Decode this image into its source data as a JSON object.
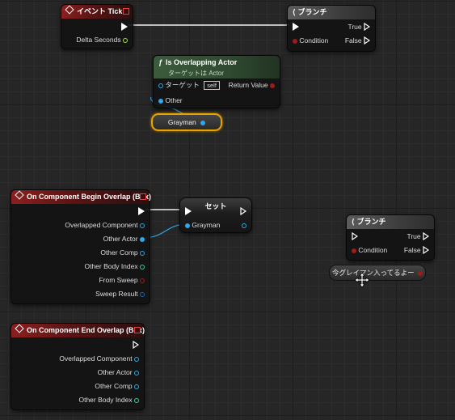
{
  "event_tick": {
    "title": "イベント Tick",
    "delta_seconds": "Delta Seconds"
  },
  "branch_top": {
    "title": "ブランチ",
    "condition": "Condition",
    "true_label": "True",
    "false_label": "False"
  },
  "is_overlapping": {
    "title": "Is Overlapping Actor",
    "subtitle": "ターゲットは Actor",
    "target": "ターゲット",
    "self": "self",
    "return_value": "Return Value",
    "other": "Other"
  },
  "grayman_get": {
    "label": "Grayman"
  },
  "begin_overlap": {
    "title": "On Component Begin Overlap (Box)",
    "pins": [
      "Overlapped Component",
      "Other Actor",
      "Other Comp",
      "Other Body Index",
      "From Sweep",
      "Sweep Result"
    ]
  },
  "set_node": {
    "title": "セット",
    "grayman": "Grayman"
  },
  "branch_bottom": {
    "title": "ブランチ",
    "condition": "Condition",
    "true_label": "True",
    "false_label": "False"
  },
  "grayman_in_get": {
    "label": "今グレイマン入ってるよー"
  },
  "end_overlap": {
    "title": "On Component End Overlap (Box)",
    "pins": [
      "Overlapped Component",
      "Other Actor",
      "Other Comp",
      "Other Body Index"
    ]
  },
  "colors": {
    "object_pin": "#2ea8ea",
    "bool_pin": "#a11b1b",
    "float_pin": "#9ee63a",
    "struct_pin": "#1565c0",
    "int_pin": "#33d6a0",
    "selection": "#e8a300"
  }
}
